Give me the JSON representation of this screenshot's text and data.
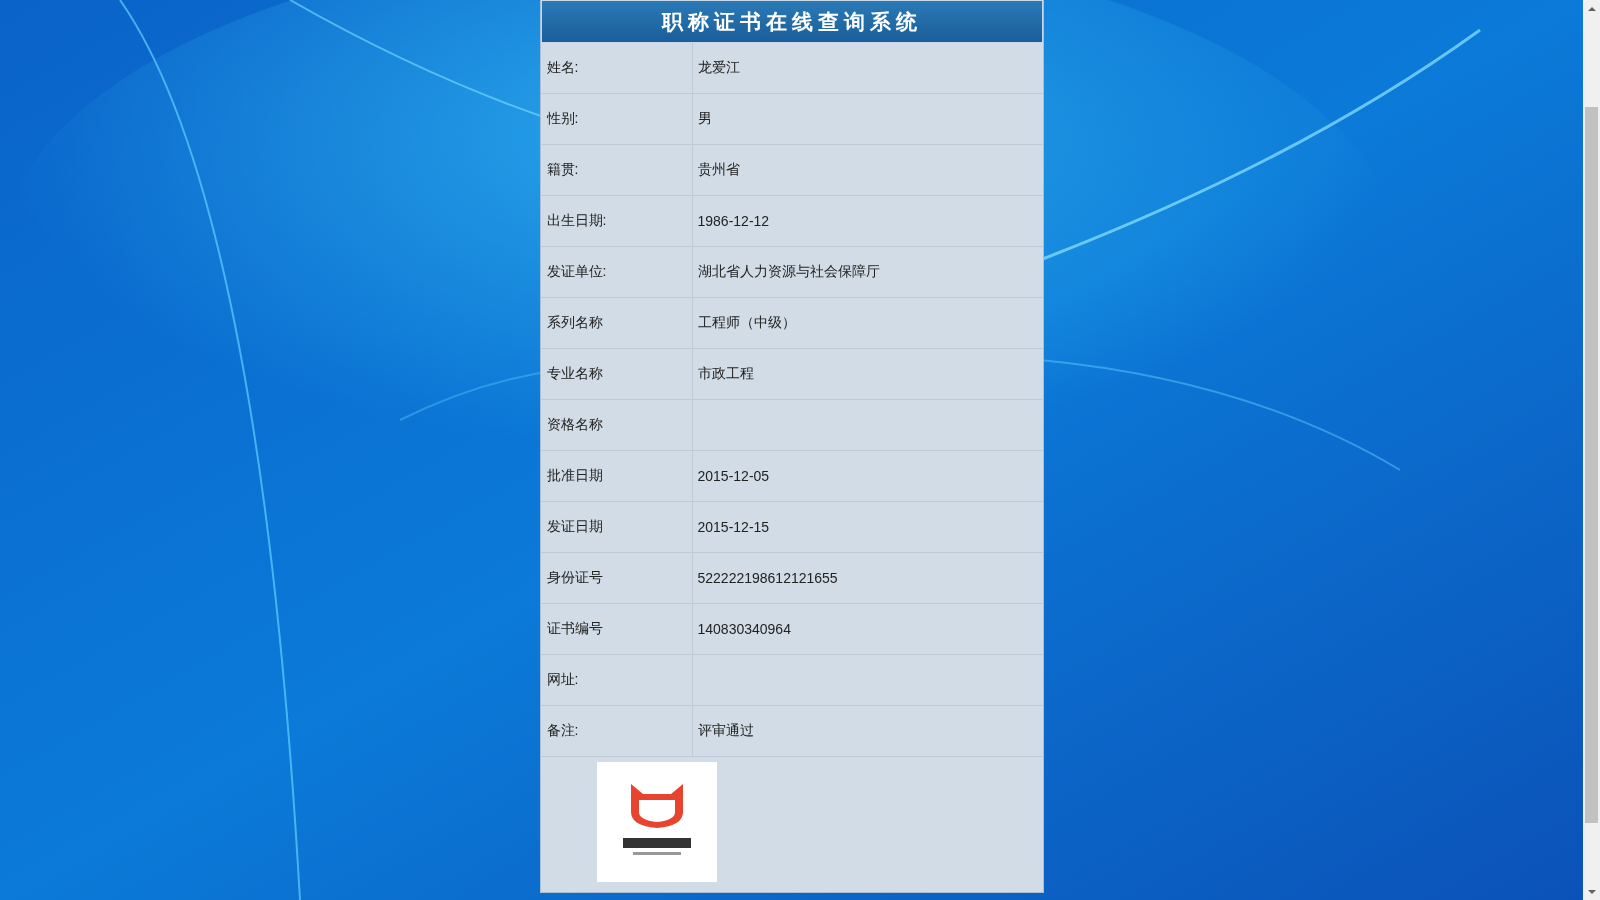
{
  "title": "职称证书在线查询系统",
  "fields": [
    {
      "label": "姓名:",
      "value": "龙爱江"
    },
    {
      "label": "性别:",
      "value": "男"
    },
    {
      "label": "籍贯:",
      "value": "贵州省"
    },
    {
      "label": "出生日期:",
      "value": "1986-12-12"
    },
    {
      "label": "发证单位:",
      "value": "湖北省人力资源与社会保障厅"
    },
    {
      "label": "系列名称",
      "value": "工程师（中级）"
    },
    {
      "label": "专业名称",
      "value": "市政工程"
    },
    {
      "label": "资格名称"
    },
    {
      "label": "批准日期",
      "value": "2015-12-05"
    },
    {
      "label": "发证日期",
      "value": "2015-12-15"
    },
    {
      "label": "身份证号",
      "value": "522222198612121655"
    },
    {
      "label": "证书编号",
      "value": "140830340964"
    },
    {
      "label": "网址:"
    },
    {
      "label": "备注:",
      "value": "评审通过"
    }
  ]
}
